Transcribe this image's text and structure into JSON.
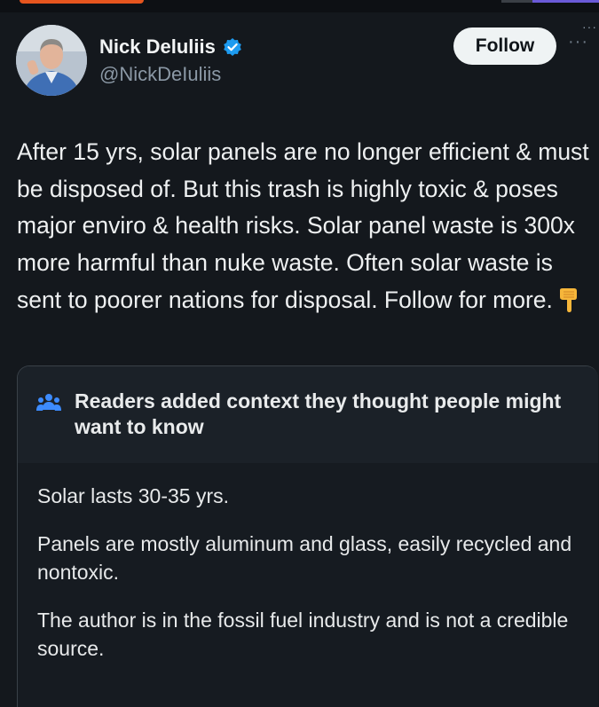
{
  "tweet": {
    "author_name": "Nick Deluliis",
    "handle": "@NickDeIuliis",
    "follow_label": "Follow",
    "more_label": "···",
    "top_more_label": "···",
    "text": "After 15 yrs, solar panels are no longer efficient & must be disposed of. But this trash is highly toxic & poses major enviro & health risks. Solar panel waste is 300x more harmful than nuke waste. Often solar waste is sent to poorer nations for disposal. Follow for more.",
    "emoji_icon": "backhand-index-pointing-down-icon",
    "verified_icon": "verified-badge-icon",
    "colors": {
      "background": "#14181d",
      "verified": "#1d9bf0",
      "follow_button": "#eff3f4",
      "note_icon": "#3d8bfd"
    }
  },
  "community_note": {
    "title": "Readers added context they thought people might want to know",
    "icon": "people-icon",
    "paragraphs": [
      "Solar lasts 30-35 yrs.",
      "Panels are mostly aluminum and glass, easily recycled and nontoxic.",
      "The author is in the fossil fuel industry and is not a credible source."
    ]
  }
}
